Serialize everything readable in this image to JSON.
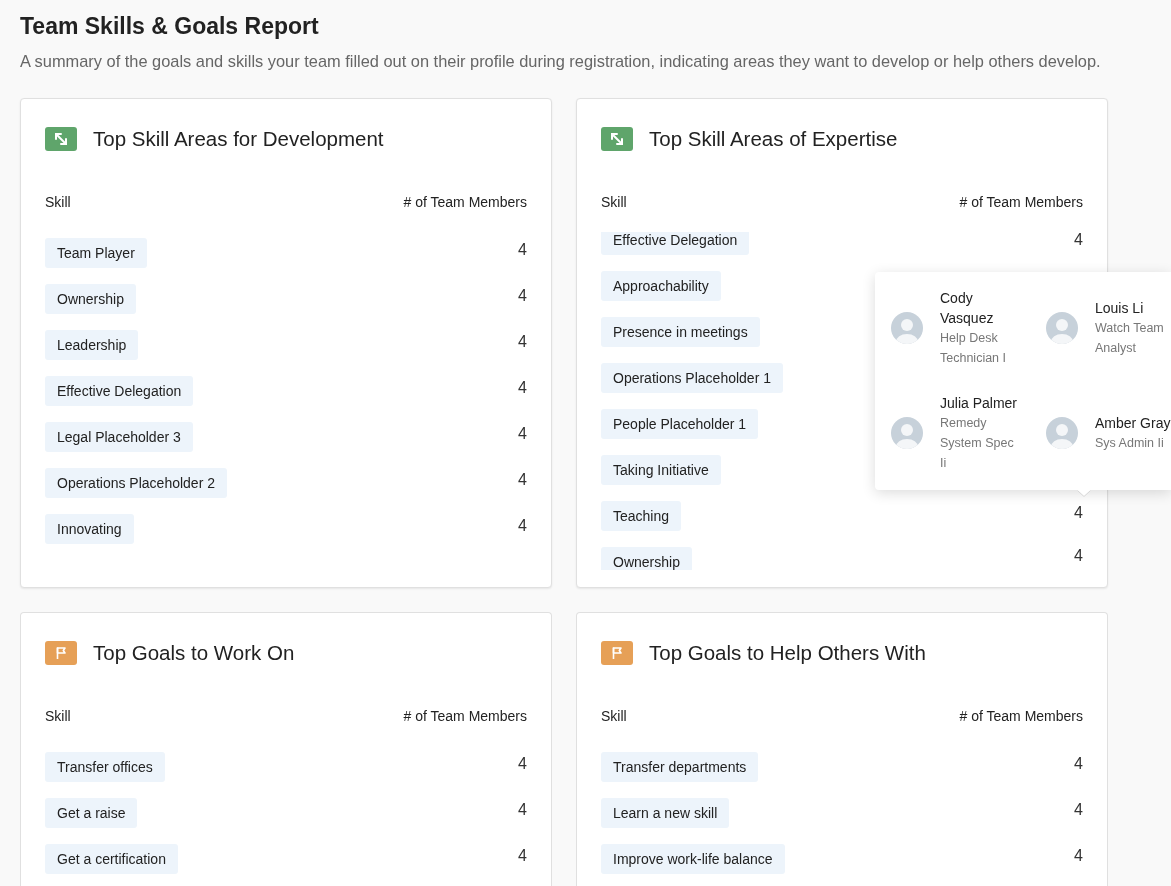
{
  "page": {
    "title": "Team Skills & Goals Report",
    "subtitle": "A summary of the goals and skills your team filled out on their profile during registration, indicating areas they want to develop or help others develop."
  },
  "cards": [
    {
      "kind": "skill",
      "title": "Top Skill Areas for Development",
      "columns": [
        "Skill",
        "# of Team Members"
      ],
      "rows": [
        {
          "kind": "full",
          "label": "Team Player",
          "count": "4"
        },
        {
          "kind": "full",
          "label": "Ownership",
          "count": "4"
        },
        {
          "kind": "full",
          "label": "Leadership",
          "count": "4"
        },
        {
          "kind": "full",
          "label": "Effective Delegation",
          "count": "4"
        },
        {
          "kind": "full",
          "label": "Legal Placeholder 3",
          "count": "4"
        },
        {
          "kind": "full",
          "label": "Operations Placeholder 2",
          "count": "4"
        },
        {
          "kind": "full",
          "label": "Innovating",
          "count": "4"
        }
      ]
    },
    {
      "kind": "skill",
      "title": "Top Skill Areas of Expertise",
      "columns": [
        "Skill",
        "# of Team Members"
      ],
      "rows": [
        {
          "kind": "cut-top",
          "label": "Effective Delegation",
          "count": "4"
        },
        {
          "kind": "full",
          "label": "Approachability"
        },
        {
          "kind": "full",
          "label": "Presence in meetings"
        },
        {
          "kind": "full",
          "label": "Operations Placeholder 1"
        },
        {
          "kind": "full",
          "label": "People Placeholder 1"
        },
        {
          "kind": "full",
          "label": "Taking Initiative"
        },
        {
          "kind": "full",
          "label": "Teaching",
          "count": "4"
        },
        {
          "kind": "cut-bottom",
          "label": "Ownership",
          "count": "4"
        }
      ]
    },
    {
      "kind": "goal",
      "title": "Top Goals to Work On",
      "columns": [
        "Skill",
        "# of Team Members"
      ],
      "rows": [
        {
          "kind": "full",
          "label": "Transfer offices",
          "count": "4"
        },
        {
          "kind": "full",
          "label": "Get a raise",
          "count": "4"
        },
        {
          "kind": "full",
          "label": "Get a certification",
          "count": "4"
        }
      ]
    },
    {
      "kind": "goal",
      "title": "Top Goals to Help Others With",
      "columns": [
        "Skill",
        "# of Team Members"
      ],
      "rows": [
        {
          "kind": "full",
          "label": "Transfer departments",
          "count": "4"
        },
        {
          "kind": "full",
          "label": "Learn a new skill",
          "count": "4"
        },
        {
          "kind": "full",
          "label": "Improve work-life balance",
          "count": "4"
        }
      ]
    }
  ],
  "tooltip": {
    "members": [
      {
        "name": "Cody Vasquez",
        "role": "Help Desk Technician I"
      },
      {
        "name": "Louis Li",
        "role": "Watch Team Analyst"
      },
      {
        "name": "Julia Palmer",
        "role": "Remedy System Spec Ii"
      },
      {
        "name": "Amber Gray",
        "role": "Sys Admin Ii"
      }
    ]
  }
}
